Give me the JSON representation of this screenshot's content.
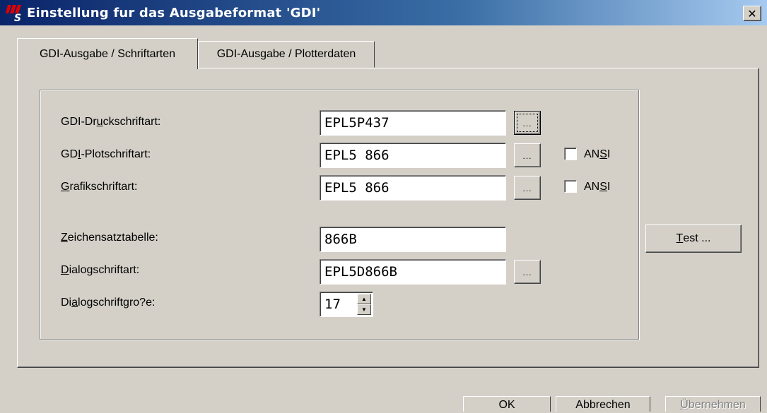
{
  "window": {
    "title": "Einstellung fur das Ausgabeformat 'GDI'",
    "close_glyph": "✕"
  },
  "tabs": [
    {
      "label": "GDI-Ausgabe / Schriftarten",
      "active": true
    },
    {
      "label": "GDI-Ausgabe / Plotterdaten",
      "active": false
    }
  ],
  "fields": {
    "druck": {
      "label_pre": "GDI-Dr",
      "label_acc": "u",
      "label_post": "ckschriftart:",
      "value": "EPL5P437",
      "button": "..."
    },
    "plot": {
      "label_pre": "GD",
      "label_acc": "I",
      "label_post": "-Plotschriftart:",
      "value": "EPL5 866",
      "button": "..."
    },
    "grafik": {
      "label_pre": "",
      "label_acc": "G",
      "label_post": "rafikschriftart:",
      "value": "EPL5 866",
      "button": "..."
    },
    "zeichensatz": {
      "label_pre": "",
      "label_acc": "Z",
      "label_post": "eichensatztabelle:",
      "value": "866B"
    },
    "dialog": {
      "label_pre": "",
      "label_acc": "D",
      "label_post": "ialogschriftart:",
      "value": "EPL5D866B",
      "button": "..."
    },
    "groesse": {
      "label_pre": "Di",
      "label_acc": "a",
      "label_post": "logschriftgro?e:",
      "value": "17"
    }
  },
  "checkboxes": {
    "plot_ansi": {
      "label_pre": "AN",
      "label_acc": "S",
      "label_post": "I",
      "checked": false
    },
    "grafik_ansi": {
      "label_pre": "AN",
      "label_acc": "S",
      "label_post": "I",
      "checked": false
    }
  },
  "buttons": {
    "test": {
      "acc": "T",
      "rest": "est ..."
    },
    "ok": "OK",
    "cancel": "Abbrechen",
    "apply": {
      "acc": "Ü",
      "rest": "bernehmen",
      "enabled": false
    }
  },
  "colors": {
    "title_start": "#0a246a",
    "title_end": "#a6caf0",
    "face": "#d4d0c8"
  }
}
